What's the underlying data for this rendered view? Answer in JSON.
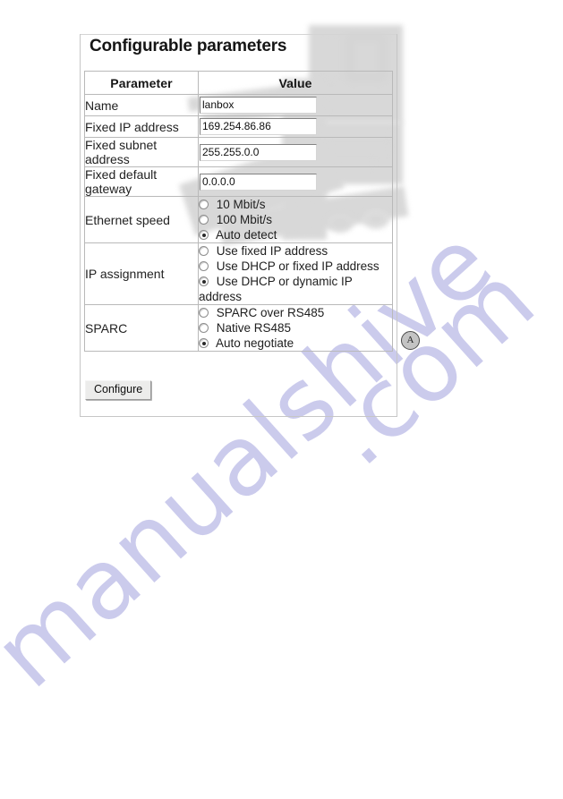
{
  "page": {
    "title": "Configurable parameters",
    "annotation_marker": "A",
    "watermark_text_1": "manualshive",
    "watermark_text_2": ".com"
  },
  "table": {
    "headers": {
      "parameter": "Parameter",
      "value": "Value"
    },
    "rows": [
      {
        "label": "Name",
        "type": "text",
        "value": "lanbox"
      },
      {
        "label": "Fixed IP address",
        "type": "text",
        "value": "169.254.86.86"
      },
      {
        "label": "Fixed subnet address",
        "type": "text",
        "value": "255.255.0.0"
      },
      {
        "label": "Fixed default gateway",
        "type": "text",
        "value": "0.0.0.0"
      },
      {
        "label": "Ethernet speed",
        "type": "radio",
        "options": [
          {
            "label": "10 Mbit/s",
            "selected": false
          },
          {
            "label": "100 Mbit/s",
            "selected": false
          },
          {
            "label": "Auto detect",
            "selected": true
          }
        ]
      },
      {
        "label": "IP assignment",
        "type": "radio",
        "options": [
          {
            "label": "Use fixed IP address",
            "selected": false
          },
          {
            "label": "Use DHCP or fixed IP address",
            "selected": false
          },
          {
            "label": "Use DHCP or dynamic IP address",
            "selected": true
          }
        ]
      },
      {
        "label": "SPARC",
        "type": "radio",
        "options": [
          {
            "label": "SPARC over RS485",
            "selected": false
          },
          {
            "label": "Native RS485",
            "selected": false
          },
          {
            "label": "Auto negotiate",
            "selected": true
          }
        ]
      }
    ]
  },
  "actions": {
    "configure_label": "Configure"
  }
}
